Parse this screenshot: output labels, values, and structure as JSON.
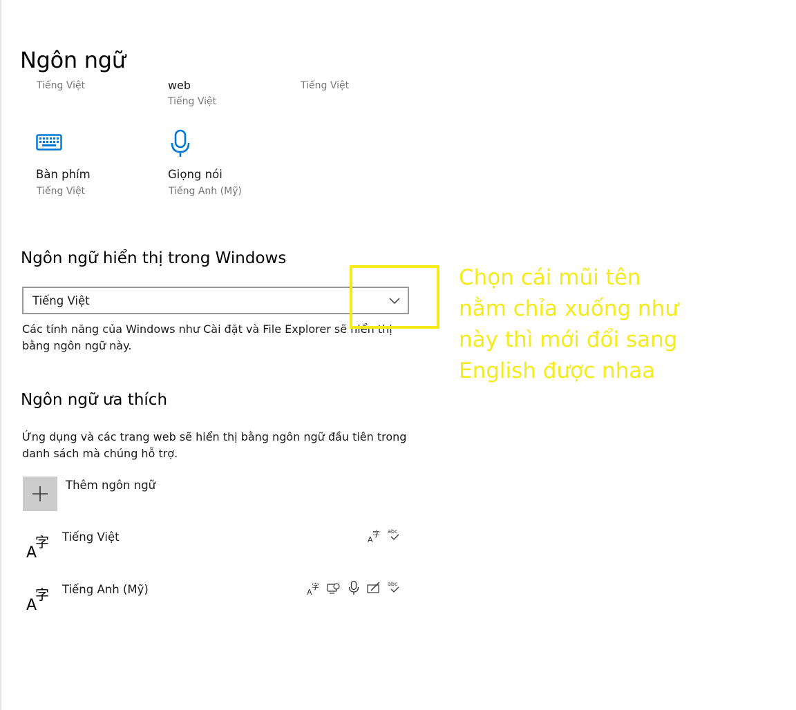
{
  "page": {
    "title": "Ngôn ngữ"
  },
  "related": {
    "top_items": [
      {
        "sub": "Tiếng Việt"
      },
      {
        "label": "web",
        "sub": "Tiếng Việt"
      },
      {
        "sub": "Tiếng Việt"
      }
    ],
    "keyboard": {
      "label": "Bàn phím",
      "sub": "Tiếng Việt",
      "icon": "keyboard-icon"
    },
    "speech": {
      "label": "Giọng nói",
      "sub": "Tiếng Anh (Mỹ)",
      "icon": "microphone-icon"
    }
  },
  "display_language": {
    "title": "Ngôn ngữ hiển thị trong Windows",
    "selected": "Tiếng Việt",
    "description": "Các tính năng của Windows như Cài đặt và File Explorer sẽ hiển thị bằng ngôn ngữ này."
  },
  "preferred": {
    "title": "Ngôn ngữ ưa thích",
    "description": "Ứng dụng và các trang web sẽ hiển thị bằng ngôn ngữ đầu tiên trong danh sách mà chúng hỗ trợ.",
    "add_label": "Thêm ngôn ngữ",
    "languages": [
      {
        "name": "Tiếng Việt",
        "features": [
          "display-language-icon",
          "spell-check-icon"
        ]
      },
      {
        "name": "Tiếng Anh (Mỹ)",
        "features": [
          "display-language-icon",
          "text-to-speech-icon",
          "speech-icon",
          "handwriting-icon",
          "spell-check-icon"
        ]
      }
    ]
  },
  "annotation": {
    "lines": [
      "Chọn cái mũi tên",
      "nằm chỉa xuống như",
      "này thì mới đổi sang",
      "English được nhaa"
    ]
  },
  "colors": {
    "accent": "#0078d7",
    "annotation": "#f4ea1c",
    "add_button_bg": "#cccccc",
    "secondary_text": "#767676"
  }
}
